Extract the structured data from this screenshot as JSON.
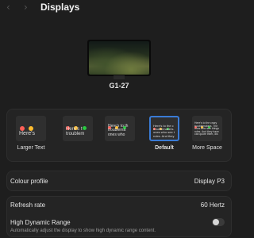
{
  "header": {
    "title": "Displays",
    "back_icon": "‹",
    "forward_icon": "›"
  },
  "display": {
    "name": "G1-27"
  },
  "scaling": {
    "options": [
      {
        "label": "Larger Text",
        "preview_text": [
          "Here's"
        ],
        "selected": false
      },
      {
        "label": "",
        "preview_text": [
          "Here's t",
          "troublem"
        ],
        "selected": false
      },
      {
        "label": "",
        "preview_text": [
          "Here's to th",
          "troublema",
          "ones who"
        ],
        "selected": false
      },
      {
        "label": "Default",
        "preview_text": [
          "Here's to the c",
          "troublemakers.",
          "ones who see t",
          "rules. And they"
        ],
        "selected": true
      },
      {
        "label": "More Space",
        "preview_text": [
          "Here's to the crazy",
          "troublemakers. The",
          "ones who see things",
          "rules. And they have",
          "can quote them, dis"
        ],
        "selected": false
      }
    ]
  },
  "colour_profile": {
    "label": "Colour profile",
    "value": "Display P3",
    "chevron_icon": "⌃"
  },
  "refresh_rate": {
    "label": "Refresh rate",
    "value": "60 Hertz",
    "chevron_icon": "⌃"
  },
  "hdr": {
    "label": "High Dynamic Range",
    "description": "Automatically adjust the display to show high dynamic range content.",
    "enabled": false
  },
  "colors": {
    "background": "#1e1e1e",
    "panel": "#242424",
    "accent": "#3a7bd5"
  }
}
